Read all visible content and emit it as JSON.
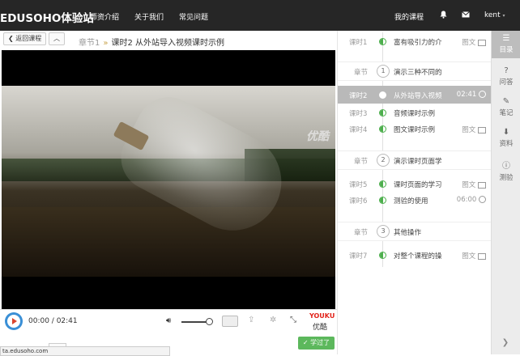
{
  "header": {
    "logo": "EDUSOHO体验站",
    "nav": [
      "师资介绍",
      "关于我们",
      "常见问题"
    ],
    "my_courses": "我的课程",
    "username": "kent",
    "bell_icon": "bell-icon",
    "mail_icon": "mail-icon"
  },
  "crumbbar": {
    "back_label": "返回课程",
    "up_icon": "chevron-up-icon",
    "chapter": "章节1",
    "separator": "»",
    "lesson": "课时2  从外站导入视频课时示例"
  },
  "video": {
    "watermark": "优酷",
    "current_time": "00:00",
    "duration": "02:41",
    "time_text": "00:00 / 02:41",
    "volume_level": 0.85,
    "youku_logo": "YOUKU",
    "youku_text": "优酷"
  },
  "learned_button": "学过了",
  "status_url": "ta.edusoho.com",
  "lessons": [
    {
      "type": "lesson",
      "label": "课时1",
      "title": "富有吸引力的介",
      "meta": "图文",
      "meta_icon": "image-icon"
    },
    {
      "type": "chapter",
      "label": "章节",
      "num": "1",
      "title": "演示三种不同的"
    },
    {
      "type": "lesson",
      "label": "课时2",
      "title": "从外站导入视频",
      "meta": "02:41",
      "meta_icon": "clock-icon",
      "active": true
    },
    {
      "type": "lesson",
      "label": "课时3",
      "title": "音频课时示例",
      "meta": ""
    },
    {
      "type": "lesson",
      "label": "课时4",
      "title": "图文课时示例",
      "meta": "图文",
      "meta_icon": "image-icon"
    },
    {
      "type": "chapter",
      "label": "章节",
      "num": "2",
      "title": "演示课时页面学"
    },
    {
      "type": "lesson",
      "label": "课时5",
      "title": "课时页面的学习",
      "meta": "图文",
      "meta_icon": "image-icon"
    },
    {
      "type": "lesson",
      "label": "课时6",
      "title": "测验的使用",
      "meta": "06:00",
      "meta_icon": "clock-icon"
    },
    {
      "type": "chapter",
      "label": "章节",
      "num": "3",
      "title": "其他操作"
    },
    {
      "type": "lesson",
      "label": "课时7",
      "title": "对整个课程的操",
      "meta": "图文",
      "meta_icon": "image-icon"
    }
  ],
  "sidebar": [
    {
      "label": "目录",
      "icon": "list-icon",
      "active": true
    },
    {
      "label": "问答",
      "icon": "question-icon"
    },
    {
      "label": "笔记",
      "icon": "edit-icon"
    },
    {
      "label": "资料",
      "icon": "download-icon"
    },
    {
      "label": "测验",
      "icon": "info-icon"
    }
  ],
  "colors": {
    "topbar": "#262626",
    "accent_green": "#5cb85c",
    "active_row": "#b9b9b9",
    "play_blue": "#3a8fd6"
  }
}
